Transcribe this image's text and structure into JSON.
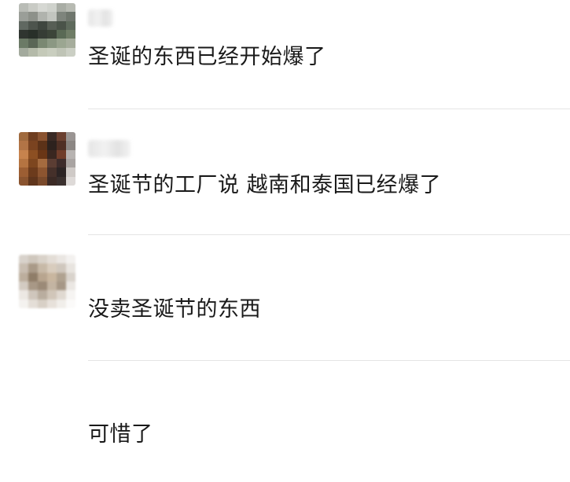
{
  "comments": [
    {
      "text": "圣诞的东西已经开始爆了"
    },
    {
      "text": "圣诞节的工厂说 越南和泰国已经爆了"
    },
    {
      "text": "没卖圣诞节的东西"
    },
    {
      "text": "可惜了"
    }
  ]
}
